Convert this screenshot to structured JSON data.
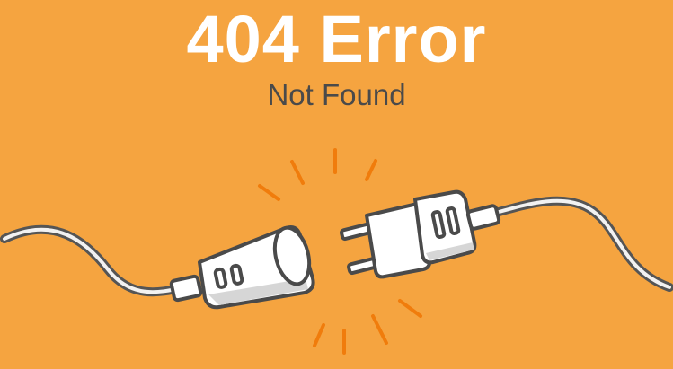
{
  "error": {
    "title": "404 Error",
    "subtitle": "Not Found"
  },
  "illustration": {
    "icon": "unplugged-cable-icon",
    "colors": {
      "background": "#F5A440",
      "cable": "#555555",
      "plug_body": "#FFFFFF",
      "plug_shadow": "#D6D6D6",
      "spark": "#F07C0C"
    }
  }
}
